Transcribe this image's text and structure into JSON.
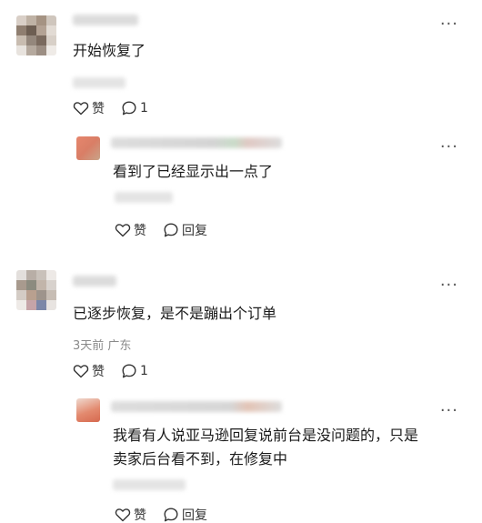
{
  "icons": {
    "more": "more-horizontal-icon",
    "like": "heart-outline-icon",
    "reply": "speech-bubble-icon"
  },
  "comments": [
    {
      "text": "开始恢复了",
      "like_label": "赞",
      "reply_count": "1"
    },
    {
      "text": "看到了已经显示出一点了",
      "like_label": "赞",
      "reply_label": "回复"
    },
    {
      "text": "已逐步恢复，是不是蹦出个订单",
      "meta": "3天前 广东",
      "like_label": "赞",
      "reply_count": "1"
    },
    {
      "text_line1": "我看有人说亚马逊回复说前台是没问题的，只是",
      "text_line2": "卖家后台看不到，在修复中",
      "like_label": "赞",
      "reply_label": "回复"
    }
  ],
  "more_glyph": "···"
}
